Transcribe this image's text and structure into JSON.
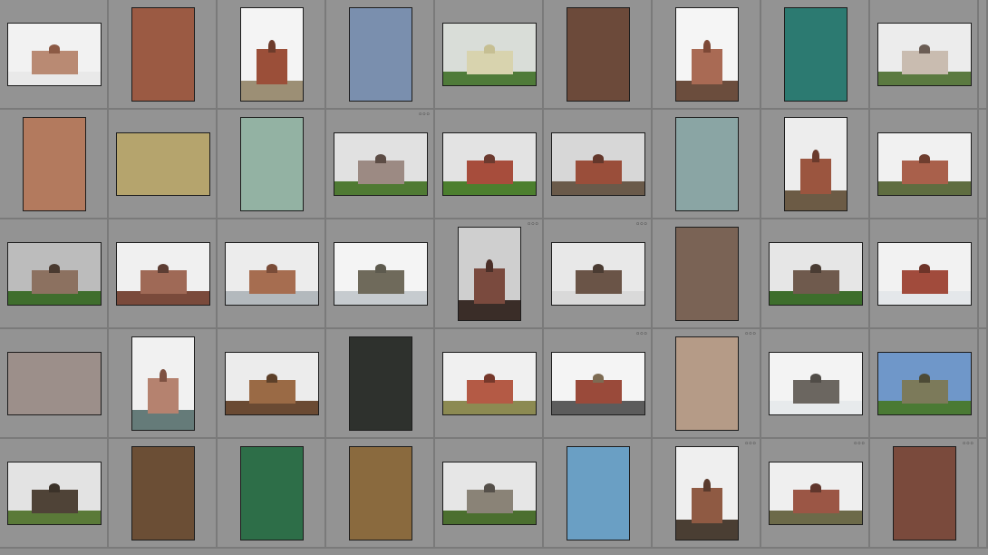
{
  "grid": {
    "columns": 9,
    "rows": 5,
    "cells": [
      {
        "orient": "land",
        "sky": "#f2f2f2",
        "ground": "#e9e9e9",
        "bld": "#b98a73",
        "dome": "#8c5a45",
        "dots": false
      },
      {
        "orient": "port",
        "wall": "#9b5a43",
        "dots": false
      },
      {
        "orient": "port",
        "sky": "#f4f4f4",
        "ground": "#9c8f75",
        "bld": "#9b4f39",
        "dome": "#6d3b2b",
        "dots": false
      },
      {
        "orient": "port",
        "wall": "#7a8fae",
        "dots": false
      },
      {
        "orient": "land",
        "sky": "#d9ddd8",
        "ground": "#4f7b39",
        "bld": "#d8d3ae",
        "dome": "#c6bf93",
        "dots": false
      },
      {
        "orient": "port",
        "wall": "#6c4a3a",
        "dots": false
      },
      {
        "orient": "port",
        "sky": "#f5f5f5",
        "ground": "#6b4d3d",
        "bld": "#a96a54",
        "dome": "#7d4836",
        "dots": false
      },
      {
        "orient": "port",
        "wall": "#2c7a71",
        "dots": false
      },
      {
        "orient": "land",
        "sky": "#ececec",
        "ground": "#5b7a40",
        "bld": "#c9bcb0",
        "dome": "#6b5d54",
        "dots": false
      },
      {
        "orient": "port",
        "wall": "#b37a5e",
        "dots": false
      },
      {
        "orient": "land",
        "wall": "#b5a46d",
        "dots": false
      },
      {
        "orient": "port",
        "wall": "#93b2a3",
        "dots": false
      },
      {
        "orient": "land",
        "sky": "#e1e1e1",
        "ground": "#4f7a33",
        "bld": "#9c8a83",
        "dome": "#5c4c45",
        "dots": true
      },
      {
        "orient": "land",
        "sky": "#e3e3e3",
        "ground": "#4c7f2e",
        "bld": "#a74d3c",
        "dome": "#6c3a2f",
        "dots": false
      },
      {
        "orient": "land",
        "sky": "#d7d7d7",
        "ground": "#6a5a4a",
        "bld": "#9a4e3a",
        "dome": "#63372b",
        "dots": false
      },
      {
        "orient": "port",
        "wall": "#8aa5a4",
        "dots": false
      },
      {
        "orient": "port",
        "sky": "#ededed",
        "ground": "#6c5b45",
        "bld": "#9b553f",
        "dome": "#6a3a2c",
        "dots": false
      },
      {
        "orient": "land",
        "sky": "#f1f1f1",
        "ground": "#5f6d40",
        "bld": "#a9604b",
        "dome": "#6f3e2f",
        "dots": false
      },
      {
        "orient": "land",
        "sky": "#bcbcbc",
        "ground": "#3f6e2d",
        "bld": "#8c7160",
        "dome": "#4a3a30",
        "dots": false
      },
      {
        "orient": "land",
        "sky": "#f0f0f0",
        "ground": "#7a4a3b",
        "bld": "#9f6956",
        "dome": "#5d3d33",
        "dots": false
      },
      {
        "orient": "land",
        "sky": "#ececec",
        "ground": "#b3b9bd",
        "bld": "#a66d50",
        "dome": "#7a4c38",
        "dots": false
      },
      {
        "orient": "land",
        "sky": "#f4f4f4",
        "ground": "#c6cbcf",
        "bld": "#6f6a5b",
        "dome": "#5d5a4e",
        "dots": false
      },
      {
        "orient": "port",
        "sky": "#cfcfcf",
        "ground": "#3a2d28",
        "bld": "#7a4a3e",
        "dome": "#4b2f28",
        "dots": true
      },
      {
        "orient": "land",
        "sky": "#e8e8e8",
        "ground": "#d9d9d9",
        "bld": "#6a5447",
        "dome": "#4a3b32",
        "dots": true
      },
      {
        "orient": "port",
        "wall": "#7a6355",
        "dots": false
      },
      {
        "orient": "land",
        "sky": "#e6e6e6",
        "ground": "#3d6e2c",
        "bld": "#6f5a4d",
        "dome": "#4a3c33",
        "dots": false
      },
      {
        "orient": "land",
        "sky": "#f2f2f2",
        "ground": "#e4e7ea",
        "bld": "#a14b3c",
        "dome": "#6e3429",
        "dots": false
      },
      {
        "orient": "land",
        "wall": "#9c8f8a",
        "dots": false
      },
      {
        "orient": "port",
        "sky": "#f1f1f1",
        "ground": "#657b79",
        "bld": "#b5826f",
        "dome": "#7e5142",
        "dots": false
      },
      {
        "orient": "land",
        "sky": "#ececec",
        "ground": "#6a4a33",
        "bld": "#9a6a45",
        "dome": "#5d4029",
        "dots": false
      },
      {
        "orient": "port",
        "wall": "#2e312d",
        "dots": false
      },
      {
        "orient": "land",
        "sky": "#f0f0f0",
        "ground": "#8c8a52",
        "bld": "#b45a45",
        "dome": "#76382b",
        "dots": false
      },
      {
        "orient": "land",
        "sky": "#f4f4f4",
        "ground": "#5c5c5c",
        "bld": "#9a4a3a",
        "dome": "#7d6b53",
        "dots": true
      },
      {
        "orient": "port",
        "wall": "#b59b87",
        "dots": true
      },
      {
        "orient": "land",
        "sky": "#f3f3f3",
        "ground": "#e7eaec",
        "bld": "#6b6660",
        "dome": "#504c47",
        "dots": false
      },
      {
        "orient": "land",
        "sky": "#6f97c9",
        "ground": "#4a7a34",
        "bld": "#7c7a5a",
        "dome": "#4d4b36",
        "dots": false
      },
      {
        "orient": "land",
        "sky": "#e3e3e3",
        "ground": "#5a7a38",
        "bld": "#4f4337",
        "dome": "#3b3229",
        "dots": false
      },
      {
        "orient": "port",
        "wall": "#6b4e35",
        "dots": false
      },
      {
        "orient": "port",
        "wall": "#2d6e48",
        "dots": false
      },
      {
        "orient": "port",
        "wall": "#8a6a3e",
        "dots": false
      },
      {
        "orient": "land",
        "sky": "#e6e6e6",
        "ground": "#4b6f2f",
        "bld": "#8a8377",
        "dome": "#55504a",
        "dots": false
      },
      {
        "orient": "port",
        "wall": "#6a9fc4",
        "dots": false
      },
      {
        "orient": "port",
        "sky": "#efefef",
        "ground": "#4a3e33",
        "bld": "#8f5a43",
        "dome": "#5a3a2c",
        "dots": true
      },
      {
        "orient": "land",
        "sky": "#efefef",
        "ground": "#6c6a49",
        "bld": "#9b5645",
        "dome": "#60362c",
        "dots": true
      },
      {
        "orient": "port",
        "wall": "#7a4a3c",
        "dots": true
      }
    ]
  }
}
